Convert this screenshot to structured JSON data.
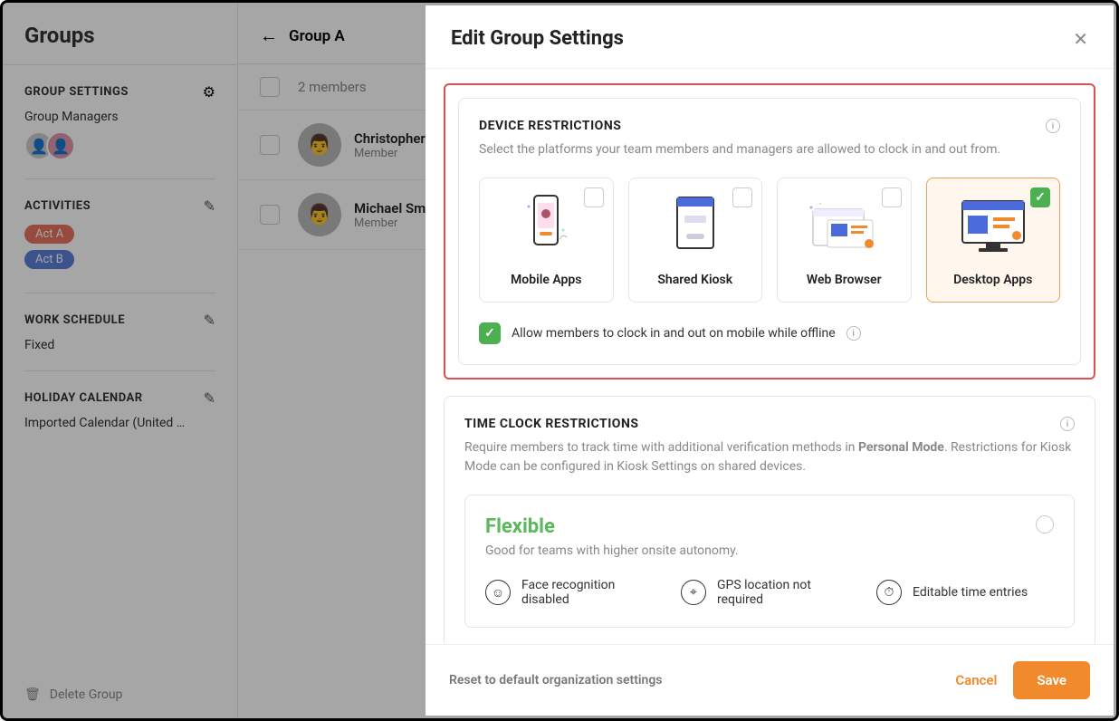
{
  "page": {
    "title": "Groups"
  },
  "sidebar": {
    "settings_heading": "GROUP SETTINGS",
    "managers_label": "Group Managers",
    "activities_heading": "ACTIVITIES",
    "activities": [
      {
        "label": "Act A",
        "color": "red"
      },
      {
        "label": "Act B",
        "color": "blue"
      }
    ],
    "schedule_heading": "WORK SCHEDULE",
    "schedule_value": "Fixed",
    "holiday_heading": "HOLIDAY CALENDAR",
    "holiday_value": "Imported Calendar (United …",
    "delete_label": "Delete Group"
  },
  "main": {
    "group_name": "Group A",
    "count_label": "2 members",
    "members": [
      {
        "name": "Christopher Sm",
        "role": "Member"
      },
      {
        "name": "Michael Sm",
        "role": "Member"
      }
    ]
  },
  "modal": {
    "title": "Edit Group Settings",
    "device": {
      "heading": "DEVICE RESTRICTIONS",
      "desc": "Select the platforms your team members and managers are allowed to clock in and out from.",
      "options": [
        {
          "label": "Mobile Apps",
          "selected": false
        },
        {
          "label": "Shared Kiosk",
          "selected": false
        },
        {
          "label": "Web Browser",
          "selected": false
        },
        {
          "label": "Desktop Apps",
          "selected": true
        }
      ],
      "offline_label": "Allow members to clock in and out on mobile while offline",
      "offline_checked": true
    },
    "clock": {
      "heading": "TIME CLOCK RESTRICTIONS",
      "desc_pre": "Require members to track time with additional verification methods in ",
      "desc_bold": "Personal Mode",
      "desc_post": ". Restrictions for Kiosk Mode can be configured in Kiosk Settings on shared devices.",
      "flexible": {
        "title": "Flexible",
        "sub": "Good for teams with higher onsite autonomy.",
        "features": [
          "Face recognition disabled",
          "GPS location not required",
          "Editable time entries"
        ]
      }
    },
    "footer": {
      "reset": "Reset to default organization settings",
      "cancel": "Cancel",
      "save": "Save"
    }
  }
}
